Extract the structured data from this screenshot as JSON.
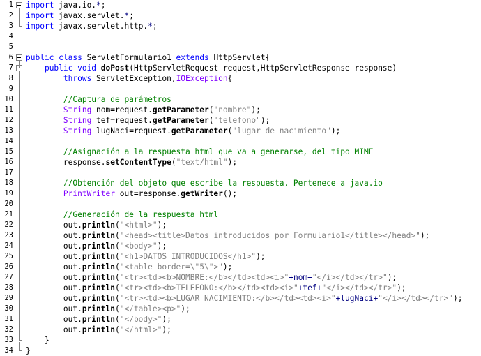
{
  "editor": {
    "lines": [
      {
        "n": "1",
        "fold": "start",
        "tokens": [
          {
            "t": "import",
            "c": "kw"
          },
          {
            "t": " java.io.",
            "c": "pl"
          },
          {
            "t": "*",
            "c": "op"
          },
          {
            "t": ";",
            "c": "pl"
          }
        ]
      },
      {
        "n": "2",
        "fold": "mid",
        "tokens": [
          {
            "t": "import",
            "c": "kw"
          },
          {
            "t": " javax.servlet.",
            "c": "pl"
          },
          {
            "t": "*",
            "c": "op"
          },
          {
            "t": ";",
            "c": "pl"
          }
        ]
      },
      {
        "n": "3",
        "fold": "end",
        "tokens": [
          {
            "t": "import",
            "c": "kw"
          },
          {
            "t": " javax.servlet.http.",
            "c": "pl"
          },
          {
            "t": "*",
            "c": "op"
          },
          {
            "t": ";",
            "c": "pl"
          }
        ]
      },
      {
        "n": "4",
        "fold": "",
        "tokens": []
      },
      {
        "n": "5",
        "fold": "",
        "tokens": []
      },
      {
        "n": "6",
        "fold": "start",
        "tokens": [
          {
            "t": "public class",
            "c": "kw"
          },
          {
            "t": " ServletFormulario1 ",
            "c": "pl"
          },
          {
            "t": "extends",
            "c": "kw"
          },
          {
            "t": " HttpServlet{",
            "c": "pl"
          }
        ]
      },
      {
        "n": "7",
        "fold": "startin",
        "tokens": [
          {
            "t": "    ",
            "c": "pl"
          },
          {
            "t": "public void",
            "c": "kw"
          },
          {
            "t": " ",
            "c": "pl"
          },
          {
            "t": "doPost",
            "c": "fn"
          },
          {
            "t": "(HttpServletRequest request,HttpServletResponse response)",
            "c": "pl"
          }
        ]
      },
      {
        "n": "8",
        "fold": "mid2",
        "tokens": [
          {
            "t": "        ",
            "c": "pl"
          },
          {
            "t": "throws",
            "c": "kw"
          },
          {
            "t": " ServletException,",
            "c": "pl"
          },
          {
            "t": "IOException",
            "c": "ex"
          },
          {
            "t": "{",
            "c": "pl"
          }
        ]
      },
      {
        "n": "9",
        "fold": "mid2",
        "tokens": []
      },
      {
        "n": "10",
        "fold": "mid2",
        "tokens": [
          {
            "t": "        ",
            "c": "pl"
          },
          {
            "t": "//Captura de parámetros",
            "c": "cm"
          }
        ]
      },
      {
        "n": "11",
        "fold": "mid2",
        "tokens": [
          {
            "t": "        ",
            "c": "pl"
          },
          {
            "t": "String",
            "c": "ty"
          },
          {
            "t": " nom=request.",
            "c": "pl"
          },
          {
            "t": "getParameter",
            "c": "fn"
          },
          {
            "t": "(",
            "c": "pl"
          },
          {
            "t": "\"nombre\"",
            "c": "st"
          },
          {
            "t": ");",
            "c": "pl"
          }
        ]
      },
      {
        "n": "12",
        "fold": "mid2",
        "tokens": [
          {
            "t": "        ",
            "c": "pl"
          },
          {
            "t": "String",
            "c": "ty"
          },
          {
            "t": " tef=request.",
            "c": "pl"
          },
          {
            "t": "getParameter",
            "c": "fn"
          },
          {
            "t": "(",
            "c": "pl"
          },
          {
            "t": "\"telefono\"",
            "c": "st"
          },
          {
            "t": ");",
            "c": "pl"
          }
        ]
      },
      {
        "n": "13",
        "fold": "mid2",
        "tokens": [
          {
            "t": "        ",
            "c": "pl"
          },
          {
            "t": "String",
            "c": "ty"
          },
          {
            "t": " lugNaci=request.",
            "c": "pl"
          },
          {
            "t": "getParameter",
            "c": "fn"
          },
          {
            "t": "(",
            "c": "pl"
          },
          {
            "t": "\"lugar de nacimiento\"",
            "c": "st"
          },
          {
            "t": ");",
            "c": "pl"
          }
        ]
      },
      {
        "n": "14",
        "fold": "mid2",
        "tokens": []
      },
      {
        "n": "15",
        "fold": "mid2",
        "tokens": [
          {
            "t": "        ",
            "c": "pl"
          },
          {
            "t": "//Asignación a la respuesta html que va a generarse, del tipo MIME",
            "c": "cm"
          }
        ]
      },
      {
        "n": "16",
        "fold": "mid2",
        "tokens": [
          {
            "t": "        response.",
            "c": "pl"
          },
          {
            "t": "setContentType",
            "c": "fn"
          },
          {
            "t": "(",
            "c": "pl"
          },
          {
            "t": "\"text/html\"",
            "c": "st"
          },
          {
            "t": ");",
            "c": "pl"
          }
        ]
      },
      {
        "n": "17",
        "fold": "mid2",
        "tokens": []
      },
      {
        "n": "18",
        "fold": "mid2",
        "tokens": [
          {
            "t": "        ",
            "c": "pl"
          },
          {
            "t": "//Obtención del objeto que escribe la respuesta. Pertenece a java.io",
            "c": "cm"
          }
        ]
      },
      {
        "n": "19",
        "fold": "mid2",
        "tokens": [
          {
            "t": "        ",
            "c": "pl"
          },
          {
            "t": "PrintWriter",
            "c": "ex"
          },
          {
            "t": " out=response.",
            "c": "pl"
          },
          {
            "t": "getWriter",
            "c": "fn"
          },
          {
            "t": "();",
            "c": "pl"
          }
        ]
      },
      {
        "n": "20",
        "fold": "mid2",
        "tokens": []
      },
      {
        "n": "21",
        "fold": "mid2",
        "tokens": [
          {
            "t": "        ",
            "c": "pl"
          },
          {
            "t": "//Generación de la respuesta html",
            "c": "cm"
          }
        ]
      },
      {
        "n": "22",
        "fold": "mid2",
        "tokens": [
          {
            "t": "        out.",
            "c": "pl"
          },
          {
            "t": "println",
            "c": "fn"
          },
          {
            "t": "(",
            "c": "pl"
          },
          {
            "t": "\"<html>\"",
            "c": "st"
          },
          {
            "t": ");",
            "c": "pl"
          }
        ]
      },
      {
        "n": "23",
        "fold": "mid2",
        "tokens": [
          {
            "t": "        out.",
            "c": "pl"
          },
          {
            "t": "println",
            "c": "fn"
          },
          {
            "t": "(",
            "c": "pl"
          },
          {
            "t": "\"<head><title>Datos introducidos por Formulario1</title></head>\"",
            "c": "st"
          },
          {
            "t": ");",
            "c": "pl"
          }
        ]
      },
      {
        "n": "24",
        "fold": "mid2",
        "tokens": [
          {
            "t": "        out.",
            "c": "pl"
          },
          {
            "t": "println",
            "c": "fn"
          },
          {
            "t": "(",
            "c": "pl"
          },
          {
            "t": "\"<body>\"",
            "c": "st"
          },
          {
            "t": ");",
            "c": "pl"
          }
        ]
      },
      {
        "n": "25",
        "fold": "mid2",
        "tokens": [
          {
            "t": "        out.",
            "c": "pl"
          },
          {
            "t": "println",
            "c": "fn"
          },
          {
            "t": "(",
            "c": "pl"
          },
          {
            "t": "\"<h1>DATOS INTRODUCIDOS</h1>\"",
            "c": "st"
          },
          {
            "t": ");",
            "c": "pl"
          }
        ]
      },
      {
        "n": "26",
        "fold": "mid2",
        "tokens": [
          {
            "t": "        out.",
            "c": "pl"
          },
          {
            "t": "println",
            "c": "fn"
          },
          {
            "t": "(",
            "c": "pl"
          },
          {
            "t": "\"<table border=\\\"5\\\">\"",
            "c": "st"
          },
          {
            "t": ");",
            "c": "pl"
          }
        ]
      },
      {
        "n": "27",
        "fold": "mid2",
        "tokens": [
          {
            "t": "        out.",
            "c": "pl"
          },
          {
            "t": "println",
            "c": "fn"
          },
          {
            "t": "(",
            "c": "pl"
          },
          {
            "t": "\"<tr><td><b>NOMBRE:</b></td><td><i>\"",
            "c": "st"
          },
          {
            "t": "+nom+",
            "c": "op"
          },
          {
            "t": "\"</i></td></tr>\"",
            "c": "st"
          },
          {
            "t": ");",
            "c": "pl"
          }
        ]
      },
      {
        "n": "28",
        "fold": "mid2",
        "tokens": [
          {
            "t": "        out.",
            "c": "pl"
          },
          {
            "t": "println",
            "c": "fn"
          },
          {
            "t": "(",
            "c": "pl"
          },
          {
            "t": "\"<tr><td><b>TELEFONO:</b></td><td><i>\"",
            "c": "st"
          },
          {
            "t": "+tef+",
            "c": "op"
          },
          {
            "t": "\"</i></td></tr>\"",
            "c": "st"
          },
          {
            "t": ");",
            "c": "pl"
          }
        ]
      },
      {
        "n": "29",
        "fold": "mid2",
        "tokens": [
          {
            "t": "        out.",
            "c": "pl"
          },
          {
            "t": "println",
            "c": "fn"
          },
          {
            "t": "(",
            "c": "pl"
          },
          {
            "t": "\"<tr><td><b>LUGAR NACIMIENTO:</b></td><td><i>\"",
            "c": "st"
          },
          {
            "t": "+lugNaci+",
            "c": "op"
          },
          {
            "t": "\"</i></td></tr>\"",
            "c": "st"
          },
          {
            "t": ");",
            "c": "pl"
          }
        ]
      },
      {
        "n": "30",
        "fold": "mid2",
        "tokens": [
          {
            "t": "        out.",
            "c": "pl"
          },
          {
            "t": "println",
            "c": "fn"
          },
          {
            "t": "(",
            "c": "pl"
          },
          {
            "t": "\"</table><p>\"",
            "c": "st"
          },
          {
            "t": ");",
            "c": "pl"
          }
        ]
      },
      {
        "n": "31",
        "fold": "mid2",
        "tokens": [
          {
            "t": "        out.",
            "c": "pl"
          },
          {
            "t": "println",
            "c": "fn"
          },
          {
            "t": "(",
            "c": "pl"
          },
          {
            "t": "\"</body>\"",
            "c": "st"
          },
          {
            "t": ");",
            "c": "pl"
          }
        ]
      },
      {
        "n": "32",
        "fold": "mid2",
        "tokens": [
          {
            "t": "        out.",
            "c": "pl"
          },
          {
            "t": "println",
            "c": "fn"
          },
          {
            "t": "(",
            "c": "pl"
          },
          {
            "t": "\"</html>\"",
            "c": "st"
          },
          {
            "t": ");",
            "c": "pl"
          }
        ]
      },
      {
        "n": "33",
        "fold": "end2",
        "tokens": [
          {
            "t": "    }",
            "c": "pl"
          }
        ]
      },
      {
        "n": "34",
        "fold": "end",
        "tokens": [
          {
            "t": "}",
            "c": "pl"
          }
        ]
      }
    ]
  },
  "colors": {
    "keyword": "#0000ff",
    "comment": "#008000",
    "string": "#808080",
    "type": "#8000ff",
    "operator": "#000080"
  }
}
